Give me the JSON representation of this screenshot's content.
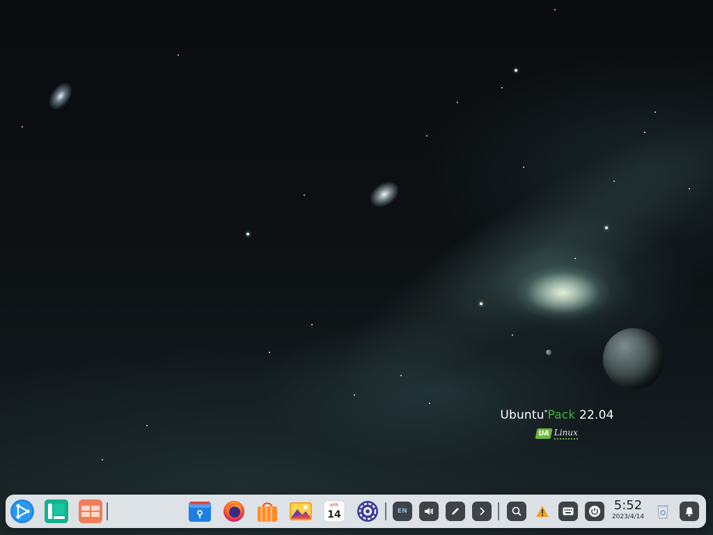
{
  "wallpaper": {
    "brand_title_part1": "Ubuntu",
    "brand_title_star": "*",
    "brand_title_part2": "Pack",
    "brand_title_part3": "22.04",
    "brand_logo_badge": "UA",
    "brand_logo_text": "Linux",
    "colors": {
      "pack_green": "#38b63d",
      "logo_green": "#6fb83c"
    }
  },
  "dock": {
    "launchers": [
      {
        "name": "launcher-icon",
        "label": ""
      },
      {
        "name": "multitasking-view-icon",
        "label": ""
      },
      {
        "name": "workspace-switcher-icon",
        "label": ""
      }
    ],
    "apps": [
      {
        "name": "file-manager-icon"
      },
      {
        "name": "firefox-icon"
      },
      {
        "name": "app-store-icon"
      },
      {
        "name": "image-viewer-icon"
      },
      {
        "name": "calendar-icon",
        "month": "APR",
        "day": "14"
      },
      {
        "name": "system-settings-icon"
      }
    ],
    "tray": {
      "keyboard_layout": "EN",
      "icons": [
        "volume-icon",
        "screenshot-pen-icon",
        "expand-tray-icon",
        "search-icon",
        "warning-icon",
        "onscreen-keyboard-icon",
        "power-icon",
        "trash-icon",
        "notifications-bell-icon"
      ]
    },
    "clock": {
      "time": "5:52",
      "date": "2023/4/14"
    }
  }
}
